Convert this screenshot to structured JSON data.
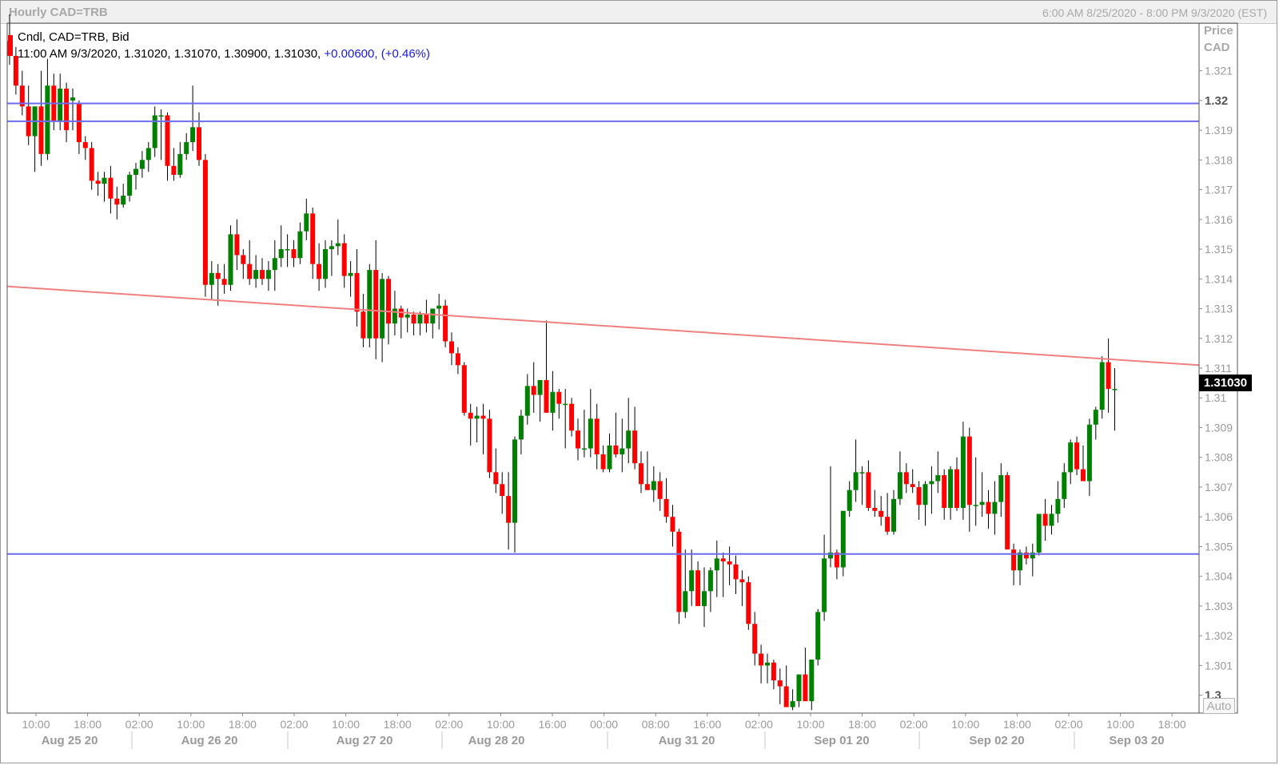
{
  "window": {
    "title": "Hourly CAD=TRB",
    "range": "6:00 AM 8/25/2020 - 8:00 PM 9/3/2020 (EST)"
  },
  "legend": {
    "line1": "Cndl, CAD=TRB, Bid",
    "line2": "11:00 AM 9/3/2020, 1.31020, 1.31070, 1.30900, 1.31030,",
    "change": "+0.00600, (+0.46%)"
  },
  "axis": {
    "title_line1": "Price",
    "title_line2": "CAD",
    "auto_label": "Auto",
    "last_price_label": "1.31030"
  },
  "colors": {
    "up": "#008000",
    "down": "#ff0000",
    "hline": "#6b6bf0",
    "trendline": "#f08080"
  },
  "chart_data": {
    "type": "candlestick",
    "title": "Hourly CAD=TRB",
    "series_name": "Cndl, CAD=TRB, Bid",
    "ylabel": "Price CAD",
    "ylim": [
      1.2994,
      1.3226
    ],
    "y_ticks": [
      "1.3",
      "1.301",
      "1.302",
      "1.303",
      "1.304",
      "1.305",
      "1.306",
      "1.307",
      "1.308",
      "1.309",
      "1.31",
      "1.311",
      "1.312",
      "1.313",
      "1.314",
      "1.315",
      "1.316",
      "1.317",
      "1.318",
      "1.319",
      "1.32",
      "1.321"
    ],
    "y_ticks_bold": [
      "1.3",
      "1.32"
    ],
    "x_time_ticks": [
      "10:00",
      "18:00",
      "02:00",
      "10:00",
      "18:00",
      "02:00",
      "10:00",
      "18:00",
      "02:00",
      "10:00",
      "16:00",
      "00:00",
      "08:00",
      "16:00",
      "02:00",
      "10:00",
      "18:00",
      "02:00",
      "10:00",
      "18:00",
      "02:00",
      "10:00",
      "18:00"
    ],
    "x_date_labels": [
      "Aug 25 20",
      "Aug 26 20",
      "Aug 27 20",
      "Aug 28 20",
      "Aug 31 20",
      "Sep 01 20",
      "Sep 02 20",
      "Sep 03 20"
    ],
    "horizontal_lines": [
      1.3199,
      1.3193,
      1.30475
    ],
    "trendline": {
      "start": 1.31375,
      "end": 1.3111
    },
    "last_close": 1.3103,
    "candles": [
      [
        1.322,
        1.3229,
        1.3212,
        1.3215
      ],
      [
        1.3215,
        1.3218,
        1.3202,
        1.3205
      ],
      [
        1.3205,
        1.321,
        1.3195,
        1.3198
      ],
      [
        1.3198,
        1.3205,
        1.3185,
        1.3188
      ],
      [
        1.3188,
        1.3197,
        1.3176,
        1.3198
      ],
      [
        1.3198,
        1.321,
        1.3178,
        1.3182
      ],
      [
        1.3182,
        1.3214,
        1.318,
        1.3205
      ],
      [
        1.3205,
        1.3209,
        1.319,
        1.3193
      ],
      [
        1.3193,
        1.3209,
        1.319,
        1.3204
      ],
      [
        1.3204,
        1.3206,
        1.3186,
        1.319
      ],
      [
        1.32,
        1.3204,
        1.319,
        1.3201
      ],
      [
        1.3199,
        1.32,
        1.3182,
        1.3186
      ],
      [
        1.3186,
        1.3188,
        1.318,
        1.3184
      ],
      [
        1.3184,
        1.3186,
        1.317,
        1.3173
      ],
      [
        1.3173,
        1.3176,
        1.3168,
        1.3172
      ],
      [
        1.3172,
        1.3176,
        1.3166,
        1.3174
      ],
      [
        1.3174,
        1.3178,
        1.3162,
        1.3167
      ],
      [
        1.3167,
        1.3171,
        1.316,
        1.3165
      ],
      [
        1.3165,
        1.3172,
        1.3164,
        1.3168
      ],
      [
        1.3168,
        1.3176,
        1.3166,
        1.3175
      ],
      [
        1.3175,
        1.3179,
        1.317,
        1.3177
      ],
      [
        1.3177,
        1.3183,
        1.3174,
        1.318
      ],
      [
        1.318,
        1.3186,
        1.3176,
        1.3184
      ],
      [
        1.3184,
        1.3198,
        1.3181,
        1.3195
      ],
      [
        1.3195,
        1.3197,
        1.318,
        1.3195
      ],
      [
        1.3195,
        1.3196,
        1.3173,
        1.3178
      ],
      [
        1.3178,
        1.3184,
        1.3173,
        1.3175
      ],
      [
        1.3175,
        1.3186,
        1.3174,
        1.3182
      ],
      [
        1.3182,
        1.3189,
        1.318,
        1.3186
      ],
      [
        1.3186,
        1.3205,
        1.3183,
        1.3191
      ],
      [
        1.3191,
        1.3196,
        1.3178,
        1.318
      ],
      [
        1.318,
        1.3182,
        1.3134,
        1.3138
      ],
      [
        1.3138,
        1.3146,
        1.3133,
        1.3142
      ],
      [
        1.3142,
        1.3145,
        1.3131,
        1.314
      ],
      [
        1.314,
        1.3145,
        1.3135,
        1.3138
      ],
      [
        1.3138,
        1.3158,
        1.3136,
        1.3155
      ],
      [
        1.3155,
        1.316,
        1.3143,
        1.3148
      ],
      [
        1.3148,
        1.315,
        1.314,
        1.3145
      ],
      [
        1.3145,
        1.3153,
        1.3138,
        1.314
      ],
      [
        1.314,
        1.3148,
        1.3137,
        1.3143
      ],
      [
        1.3143,
        1.3147,
        1.3138,
        1.314
      ],
      [
        1.314,
        1.3146,
        1.3136,
        1.3143
      ],
      [
        1.3143,
        1.3153,
        1.3136,
        1.3147
      ],
      [
        1.3147,
        1.3158,
        1.3144,
        1.315
      ],
      [
        1.315,
        1.3155,
        1.3144,
        1.315
      ],
      [
        1.315,
        1.3153,
        1.3144,
        1.3147
      ],
      [
        1.3147,
        1.3159,
        1.3145,
        1.3156
      ],
      [
        1.3156,
        1.3167,
        1.3153,
        1.3162
      ],
      [
        1.3162,
        1.3164,
        1.314,
        1.3145
      ],
      [
        1.3145,
        1.3152,
        1.3136,
        1.314
      ],
      [
        1.314,
        1.3153,
        1.3137,
        1.315
      ],
      [
        1.315,
        1.3153,
        1.3141,
        1.3151
      ],
      [
        1.3151,
        1.316,
        1.3148,
        1.3152
      ],
      [
        1.3152,
        1.3155,
        1.3137,
        1.3141
      ],
      [
        1.3141,
        1.3146,
        1.3134,
        1.3142
      ],
      [
        1.3142,
        1.315,
        1.3124,
        1.3129
      ],
      [
        1.3129,
        1.3135,
        1.3117,
        1.312
      ],
      [
        1.312,
        1.3145,
        1.3117,
        1.3143
      ],
      [
        1.3143,
        1.3153,
        1.3113,
        1.312
      ],
      [
        1.312,
        1.3142,
        1.3112,
        1.314
      ],
      [
        1.314,
        1.3141,
        1.3118,
        1.3125
      ],
      [
        1.3125,
        1.3136,
        1.3121,
        1.313
      ],
      [
        1.313,
        1.3131,
        1.312,
        1.3127
      ],
      [
        1.3127,
        1.313,
        1.3122,
        1.3128
      ],
      [
        1.3128,
        1.3129,
        1.3121,
        1.3125
      ],
      [
        1.3125,
        1.3129,
        1.3121,
        1.3128
      ],
      [
        1.3128,
        1.3133,
        1.3122,
        1.3125
      ],
      [
        1.3125,
        1.313,
        1.312,
        1.313
      ],
      [
        1.313,
        1.3135,
        1.3123,
        1.3131
      ],
      [
        1.3131,
        1.3133,
        1.3117,
        1.3119
      ],
      [
        1.3119,
        1.3122,
        1.3111,
        1.3115
      ],
      [
        1.3115,
        1.3117,
        1.3108,
        1.3111
      ],
      [
        1.3111,
        1.3112,
        1.3094,
        1.3095
      ],
      [
        1.3095,
        1.3098,
        1.3084,
        1.3093
      ],
      [
        1.3093,
        1.3097,
        1.3085,
        1.3094
      ],
      [
        1.3094,
        1.3098,
        1.3081,
        1.3093
      ],
      [
        1.3093,
        1.3096,
        1.3073,
        1.3075
      ],
      [
        1.3075,
        1.3083,
        1.3068,
        1.3071
      ],
      [
        1.3071,
        1.3075,
        1.3061,
        1.3067
      ],
      [
        1.3067,
        1.3075,
        1.3049,
        1.3058
      ],
      [
        1.3058,
        1.3087,
        1.3048,
        1.3086
      ],
      [
        1.3086,
        1.3096,
        1.3081,
        1.3094
      ],
      [
        1.3094,
        1.3108,
        1.3091,
        1.3104
      ],
      [
        1.3104,
        1.3112,
        1.3095,
        1.3101
      ],
      [
        1.3101,
        1.3105,
        1.3092,
        1.3106
      ],
      [
        1.3106,
        1.3126,
        1.3095,
        1.3095
      ],
      [
        1.3095,
        1.3109,
        1.3089,
        1.3102
      ],
      [
        1.3102,
        1.3103,
        1.3093,
        1.3098
      ],
      [
        1.3098,
        1.3103,
        1.3083,
        1.3098
      ],
      [
        1.3098,
        1.31,
        1.3087,
        1.3089
      ],
      [
        1.3089,
        1.3093,
        1.3079,
        1.3083
      ],
      [
        1.3083,
        1.3096,
        1.308,
        1.3083
      ],
      [
        1.3083,
        1.3103,
        1.308,
        1.3093
      ],
      [
        1.3093,
        1.3098,
        1.3076,
        1.3081
      ],
      [
        1.3081,
        1.3084,
        1.3075,
        1.3076
      ],
      [
        1.3076,
        1.3088,
        1.3075,
        1.3084
      ],
      [
        1.3084,
        1.3095,
        1.308,
        1.3081
      ],
      [
        1.3081,
        1.3093,
        1.3075,
        1.3083
      ],
      [
        1.3083,
        1.31,
        1.3078,
        1.3089
      ],
      [
        1.3089,
        1.3097,
        1.3076,
        1.3078
      ],
      [
        1.3078,
        1.3082,
        1.3068,
        1.3071
      ],
      [
        1.3071,
        1.3082,
        1.3069,
        1.3069
      ],
      [
        1.3069,
        1.3077,
        1.3065,
        1.3072
      ],
      [
        1.3072,
        1.3075,
        1.3062,
        1.3066
      ],
      [
        1.3066,
        1.3073,
        1.3058,
        1.306
      ],
      [
        1.306,
        1.3064,
        1.305,
        1.3055
      ],
      [
        1.3055,
        1.3056,
        1.3024,
        1.3028
      ],
      [
        1.3028,
        1.3049,
        1.3026,
        1.3035
      ],
      [
        1.3035,
        1.3049,
        1.303,
        1.3042
      ],
      [
        1.3042,
        1.3045,
        1.303,
        1.303
      ],
      [
        1.303,
        1.3043,
        1.3023,
        1.3035
      ],
      [
        1.3035,
        1.3043,
        1.3028,
        1.3042
      ],
      [
        1.3042,
        1.3052,
        1.3033,
        1.3046
      ],
      [
        1.3046,
        1.3048,
        1.3033,
        1.3045
      ],
      [
        1.3045,
        1.305,
        1.3037,
        1.3044
      ],
      [
        1.3044,
        1.3047,
        1.3034,
        1.3039
      ],
      [
        1.3039,
        1.3042,
        1.303,
        1.3038
      ],
      [
        1.3038,
        1.304,
        1.3022,
        1.3024
      ],
      [
        1.3024,
        1.3028,
        1.301,
        1.3014
      ],
      [
        1.3014,
        1.3017,
        1.3004,
        1.301
      ],
      [
        1.301,
        1.3014,
        1.3004,
        1.3011
      ],
      [
        1.3011,
        1.3012,
        1.3002,
        1.3005
      ],
      [
        1.3005,
        1.3009,
        1.2997,
        1.3003
      ],
      [
        1.3003,
        1.301,
        1.2997,
        1.2996
      ],
      [
        1.2996,
        1.3002,
        1.2995,
        1.2998
      ],
      [
        1.2998,
        1.3007,
        1.2996,
        1.3007
      ],
      [
        1.3007,
        1.3016,
        1.3003,
        1.2998
      ],
      [
        1.2998,
        1.3012,
        1.2995,
        1.3012
      ],
      [
        1.3012,
        1.3029,
        1.301,
        1.3028
      ],
      [
        1.3028,
        1.3054,
        1.3025,
        1.3046
      ],
      [
        1.3046,
        1.3077,
        1.3043,
        1.3048
      ],
      [
        1.3048,
        1.3049,
        1.3039,
        1.3043
      ],
      [
        1.3043,
        1.3062,
        1.304,
        1.3062
      ],
      [
        1.3062,
        1.3072,
        1.306,
        1.3069
      ],
      [
        1.3069,
        1.3086,
        1.3065,
        1.3075
      ],
      [
        1.3075,
        1.3077,
        1.3064,
        1.3075
      ],
      [
        1.3075,
        1.3079,
        1.3062,
        1.3063
      ],
      [
        1.3063,
        1.3069,
        1.306,
        1.3062
      ],
      [
        1.3062,
        1.3067,
        1.3057,
        1.306
      ],
      [
        1.306,
        1.3068,
        1.3054,
        1.3055
      ],
      [
        1.3055,
        1.3069,
        1.3054,
        1.3066
      ],
      [
        1.3066,
        1.3082,
        1.3064,
        1.3075
      ],
      [
        1.3075,
        1.3078,
        1.3068,
        1.3071
      ],
      [
        1.3071,
        1.3076,
        1.3068,
        1.307
      ],
      [
        1.307,
        1.3072,
        1.3059,
        1.3064
      ],
      [
        1.3064,
        1.3072,
        1.3057,
        1.3071
      ],
      [
        1.3071,
        1.3077,
        1.3061,
        1.3072
      ],
      [
        1.3072,
        1.3082,
        1.3068,
        1.3074
      ],
      [
        1.3074,
        1.3076,
        1.3059,
        1.3063
      ],
      [
        1.3063,
        1.3077,
        1.3059,
        1.3076
      ],
      [
        1.3076,
        1.308,
        1.3062,
        1.3063
      ],
      [
        1.3063,
        1.3092,
        1.3059,
        1.3087
      ],
      [
        1.3087,
        1.309,
        1.3055,
        1.3064
      ],
      [
        1.3064,
        1.308,
        1.3057,
        1.3064
      ],
      [
        1.3064,
        1.3075,
        1.306,
        1.3065
      ],
      [
        1.3065,
        1.3069,
        1.3056,
        1.3061
      ],
      [
        1.3061,
        1.3072,
        1.3054,
        1.3065
      ],
      [
        1.3065,
        1.3078,
        1.306,
        1.3074
      ],
      [
        1.3074,
        1.3075,
        1.3051,
        1.3049
      ],
      [
        1.3049,
        1.3051,
        1.3037,
        1.3042
      ],
      [
        1.3042,
        1.3049,
        1.3037,
        1.3048
      ],
      [
        1.3048,
        1.305,
        1.3044,
        1.3046
      ],
      [
        1.3046,
        1.3051,
        1.304,
        1.3048
      ],
      [
        1.3048,
        1.3061,
        1.3047,
        1.3061
      ],
      [
        1.3061,
        1.3066,
        1.3052,
        1.3057
      ],
      [
        1.3057,
        1.3064,
        1.3054,
        1.3061
      ],
      [
        1.3061,
        1.3072,
        1.3058,
        1.3066
      ],
      [
        1.3066,
        1.3078,
        1.3063,
        1.3075
      ],
      [
        1.3075,
        1.3086,
        1.3071,
        1.3085
      ],
      [
        1.3085,
        1.3087,
        1.3074,
        1.3076
      ],
      [
        1.3076,
        1.3084,
        1.3072,
        1.3072
      ],
      [
        1.3072,
        1.3093,
        1.3067,
        1.3091
      ],
      [
        1.3091,
        1.3097,
        1.3086,
        1.3096
      ],
      [
        1.3096,
        1.3114,
        1.3093,
        1.3112
      ],
      [
        1.3112,
        1.312,
        1.3095,
        1.3103
      ],
      [
        1.3103,
        1.311,
        1.3089,
        1.3103
      ]
    ]
  }
}
